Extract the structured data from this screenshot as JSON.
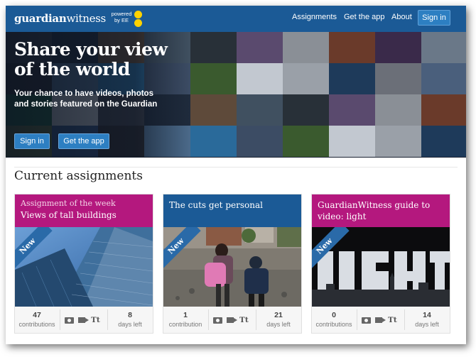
{
  "nav": {
    "logo_bold": "guardian",
    "logo_light": "witness",
    "powered_by": "powered by EE",
    "links": [
      "Assignments",
      "Get the app",
      "About"
    ],
    "signin": "Sign in"
  },
  "hero": {
    "title": "Share your view of the world",
    "subtitle": "Your chance to have videos, photos and stories featured on the Guardian",
    "buttons": [
      "Sign in",
      "Get the app"
    ]
  },
  "section": {
    "title": "Current assignments"
  },
  "cards": [
    {
      "kicker": "Assignment of the week",
      "title": "Views of tall buildings",
      "badge": "New",
      "contributions": "47",
      "contributions_label": "contributions",
      "days": "8",
      "days_label": "days left",
      "media_text": "Tt",
      "head_color": "#b4187e"
    },
    {
      "kicker": "",
      "title": "The cuts get personal",
      "badge": "New",
      "contributions": "1",
      "contributions_label": "contribution",
      "days": "21",
      "days_label": "days left",
      "media_text": "Tt",
      "head_color": "#1b5a96"
    },
    {
      "kicker": "",
      "title": "GuardianWitness guide to video: light",
      "badge": "New",
      "contributions": "0",
      "contributions_label": "contributions",
      "days": "14",
      "days_label": "days left",
      "media_text": "Tt",
      "head_color": "#b4187e"
    }
  ],
  "colors": {
    "nav": "#1b5a96",
    "button": "#2d7fc2",
    "magenta": "#b4187e",
    "ee_yellow": "#ffd200"
  }
}
